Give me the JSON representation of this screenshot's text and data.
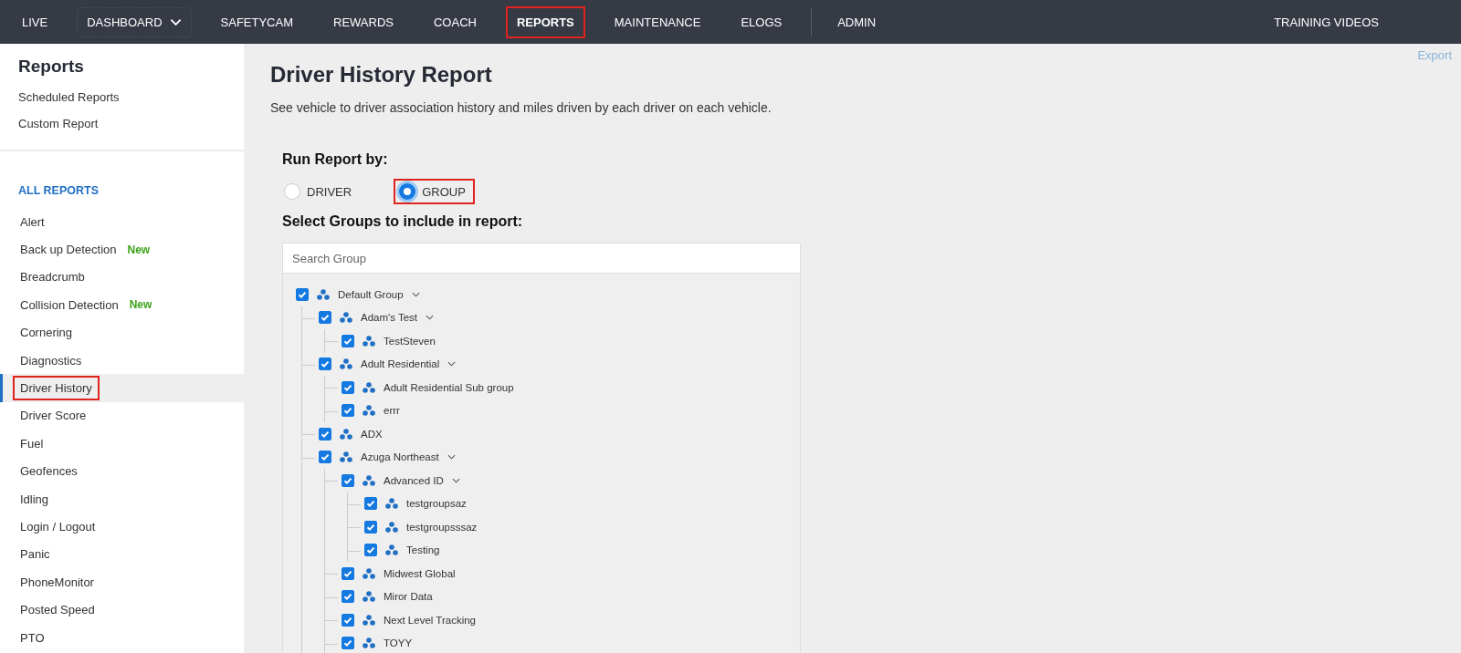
{
  "nav": {
    "items": [
      {
        "label": "LIVE",
        "selected": false,
        "highlighted": false,
        "dropdown": false
      },
      {
        "label": "DASHBOARD",
        "selected": false,
        "highlighted": false,
        "dropdown": true
      },
      {
        "label": "SAFETYCAM",
        "selected": false,
        "highlighted": false,
        "dropdown": false
      },
      {
        "label": "REWARDS",
        "selected": false,
        "highlighted": false,
        "dropdown": false
      },
      {
        "label": "COACH",
        "selected": false,
        "highlighted": false,
        "dropdown": false
      },
      {
        "label": "REPORTS",
        "selected": true,
        "highlighted": true,
        "dropdown": false
      },
      {
        "label": "MAINTENANCE",
        "selected": false,
        "highlighted": false,
        "dropdown": false
      },
      {
        "label": "ELOGS",
        "selected": false,
        "highlighted": false,
        "dropdown": false
      }
    ],
    "admin": "ADMIN",
    "right": "TRAINING VIDEOS"
  },
  "sidebar": {
    "title": "Reports",
    "links": [
      "Scheduled Reports",
      "Custom Report"
    ],
    "section": "ALL REPORTS",
    "items": [
      {
        "label": "Alert",
        "selected": false,
        "highlighted": false
      },
      {
        "label": "Back up Detection",
        "badge": "New",
        "selected": false,
        "highlighted": false
      },
      {
        "label": "Breadcrumb",
        "selected": false,
        "highlighted": false
      },
      {
        "label": "Collision Detection",
        "badge": "New",
        "selected": false,
        "highlighted": false
      },
      {
        "label": "Cornering",
        "selected": false,
        "highlighted": false
      },
      {
        "label": "Diagnostics",
        "selected": false,
        "highlighted": false
      },
      {
        "label": "Driver History",
        "selected": true,
        "highlighted": true
      },
      {
        "label": "Driver Score",
        "selected": false,
        "highlighted": false
      },
      {
        "label": "Fuel",
        "selected": false,
        "highlighted": false
      },
      {
        "label": "Geofences",
        "selected": false,
        "highlighted": false
      },
      {
        "label": "Idling",
        "selected": false,
        "highlighted": false
      },
      {
        "label": "Login / Logout",
        "selected": false,
        "highlighted": false
      },
      {
        "label": "Panic",
        "selected": false,
        "highlighted": false
      },
      {
        "label": "PhoneMonitor",
        "selected": false,
        "highlighted": false
      },
      {
        "label": "Posted Speed",
        "selected": false,
        "highlighted": false
      },
      {
        "label": "PTO",
        "selected": false,
        "highlighted": false
      }
    ]
  },
  "main": {
    "export": "Export",
    "title": "Driver History Report",
    "description": "See vehicle to driver association history and miles driven by each driver on each vehicle.",
    "run_by_label": "Run Report by:",
    "run_by_options": [
      {
        "label": "DRIVER",
        "selected": false,
        "highlighted": false
      },
      {
        "label": "GROUP",
        "selected": true,
        "highlighted": true
      }
    ],
    "groups_label": "Select Groups to include in report:",
    "search": {
      "placeholder": "Search Group"
    },
    "tree": [
      {
        "label": "Default Group",
        "checked": true,
        "expanded": true,
        "children": [
          {
            "label": "Adam's Test",
            "checked": true,
            "expanded": true,
            "children": [
              {
                "label": "TestSteven",
                "checked": true
              }
            ]
          },
          {
            "label": "Adult Residential",
            "checked": true,
            "expanded": true,
            "children": [
              {
                "label": "Adult Residential Sub group",
                "checked": true
              },
              {
                "label": "errr",
                "checked": true
              }
            ]
          },
          {
            "label": "ADX",
            "checked": true
          },
          {
            "label": "Azuga Northeast",
            "checked": true,
            "expanded": true,
            "children": [
              {
                "label": "Advanced ID",
                "checked": true,
                "expanded": true,
                "children": [
                  {
                    "label": "testgroupsaz",
                    "checked": true
                  },
                  {
                    "label": "testgroupsssaz",
                    "checked": true
                  },
                  {
                    "label": "Testing",
                    "checked": true
                  }
                ]
              },
              {
                "label": "Midwest Global",
                "checked": true
              },
              {
                "label": "Miror Data",
                "checked": true
              },
              {
                "label": "Next Level Tracking",
                "checked": true
              },
              {
                "label": "TOYY",
                "checked": true
              }
            ]
          }
        ]
      }
    ]
  }
}
